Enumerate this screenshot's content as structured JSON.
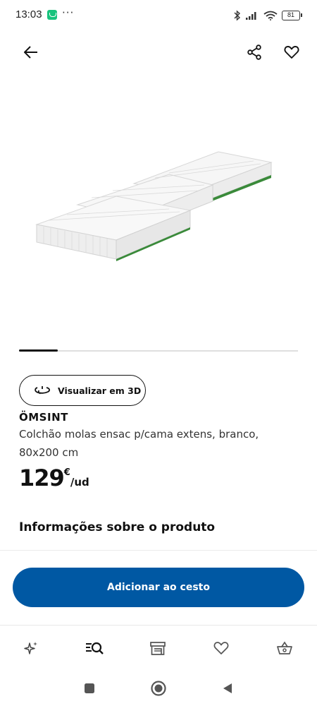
{
  "status_bar": {
    "time": "13:03",
    "dots": "···",
    "battery": "81",
    "icons": [
      "app-notification-icon",
      "bluetooth-icon",
      "signal-icon",
      "wifi-icon",
      "battery-icon"
    ]
  },
  "header": {
    "back_icon": "arrow-left-icon",
    "share_icon": "share-icon",
    "favorite_icon": "heart-icon"
  },
  "gallery": {
    "progress": 0.14
  },
  "view_3d": {
    "label": "Visualizar em 3D",
    "icon": "rotate-3d-icon"
  },
  "product": {
    "name": "ÖMSINT",
    "description": "Colchão molas ensac p/cama extens, branco, 80x200 cm",
    "price_integer": "129",
    "currency": "€",
    "unit": "/ud"
  },
  "info": {
    "title": "Informações sobre o produto"
  },
  "add_to_cart": {
    "label": "Adicionar ao cesto",
    "color": "#0058a3"
  },
  "bottom_nav": {
    "items": [
      {
        "icon": "sparkle-icon",
        "active": false
      },
      {
        "icon": "search-list-icon",
        "active": true
      },
      {
        "icon": "store-icon",
        "active": false
      },
      {
        "icon": "heart-icon",
        "active": false
      },
      {
        "icon": "basket-icon",
        "active": false
      }
    ]
  },
  "system_nav": {
    "icons": [
      "recents-icon",
      "home-icon",
      "back-icon"
    ]
  }
}
